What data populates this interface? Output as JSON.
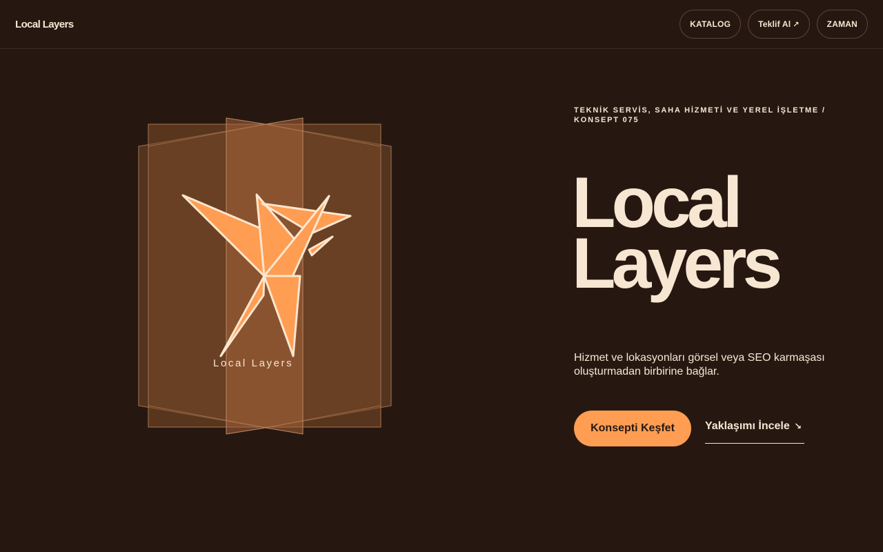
{
  "header": {
    "brand": "Local Layers",
    "nav": [
      {
        "label": "KATALOG"
      },
      {
        "label": "Teklif Al",
        "icon": "arrow-up-right-icon",
        "glyph": "↗"
      },
      {
        "label": "ZAMAN"
      }
    ]
  },
  "hero": {
    "eyebrow": "TEKNİK SERVİS, SAHA HİZMETİ VE YEREL İŞLETME / KONSEPT 075",
    "title_line1": "Local",
    "title_line2": "Layers",
    "description": "Hizmet ve lokasyonları görsel veya SEO karmaşası oluşturmadan birbirine bağlar.",
    "primary_cta": "Konsepti Keşfet",
    "secondary_cta": "Yaklaşımı İncele",
    "secondary_cta_icon": "arrow-down-right-icon",
    "secondary_cta_glyph": "↘"
  },
  "illustration": {
    "caption": "Local Layers",
    "bird_icon": "origami-bird-icon"
  },
  "colors": {
    "background": "#261811",
    "text": "#f6e6d2",
    "accent": "#ff9d52"
  }
}
